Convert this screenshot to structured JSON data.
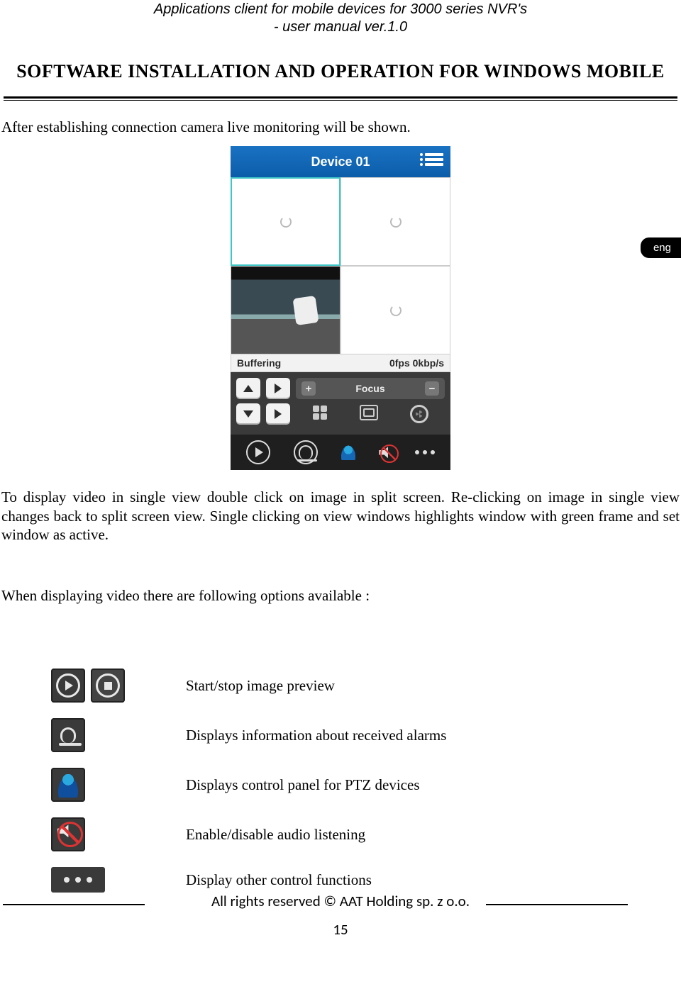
{
  "header": {
    "line1": "Applications client for mobile devices for 3000 series NVR's",
    "line2": "- user manual ver.1.0"
  },
  "section_title": "SOFTWARE INSTALLATION AND OPERATION FOR WINDOWS MOBILE",
  "lang_tab": "eng",
  "paragraphs": {
    "intro": "After establishing connection camera live monitoring will be shown.",
    "after_shot": "To display video in single view double click on image in split screen. Re-clicking on image in single view changes back to split screen view. Single clicking on view windows highlights window with green frame and set window as active.",
    "options_intro": "When displaying video there are following options available :"
  },
  "screenshot": {
    "title": "Device 01",
    "status_left": "Buffering",
    "status_right": "0fps 0kbp/s",
    "focus_label": "Focus",
    "plus": "+",
    "minus": "−"
  },
  "options": [
    {
      "desc": "Start/stop image preview"
    },
    {
      "desc": "Displays information about received alarms"
    },
    {
      "desc": "Displays control panel for PTZ devices"
    },
    {
      "desc": "Enable/disable audio listening"
    },
    {
      "desc": "Display other control functions"
    }
  ],
  "footer": {
    "rights": "All rights reserved © AAT Holding sp. z o.o.",
    "page": "15"
  }
}
